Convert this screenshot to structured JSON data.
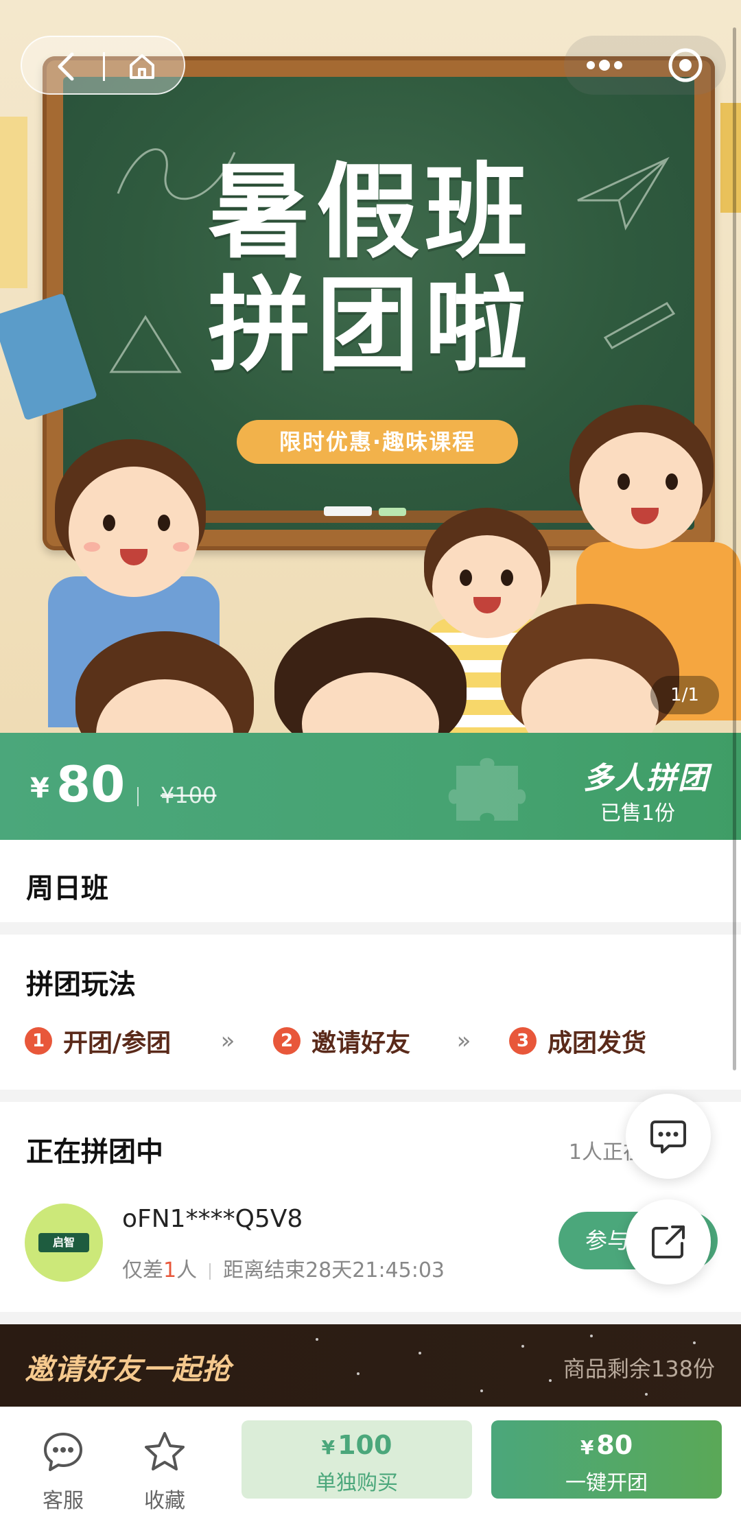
{
  "hero": {
    "title_line1": "暑假班",
    "title_line2": "拼团啦",
    "tagline": "限时优惠·趣味课程",
    "page_indicator": "1/1"
  },
  "nav": {
    "back_icon": "chevron-left-icon",
    "home_icon": "home-icon",
    "more_icon": "more-dots-icon",
    "close_icon": "target-icon"
  },
  "price": {
    "currency": "¥",
    "current": "80",
    "original": "¥100",
    "badge": "多人拼团",
    "sold": "已售1份"
  },
  "product": {
    "name": "周日班"
  },
  "rules": {
    "title": "拼团玩法",
    "steps": [
      {
        "num": "1",
        "label": "开团/参团"
      },
      {
        "num": "2",
        "label": "邀请好友"
      },
      {
        "num": "3",
        "label": "成团发货"
      }
    ],
    "arrow": "»"
  },
  "ongoing": {
    "title": "正在拼团中",
    "side_text": "1人正在拼",
    "member": {
      "avatar_text": "启智",
      "name": "oFN1****Q5V8",
      "need_prefix": "仅差",
      "need_count": "1",
      "need_suffix": "人",
      "countdown": "距离结束28天21:45:03"
    },
    "join_label": "参与"
  },
  "promo": {
    "title": "邀请好友一起抢",
    "stock": "商品剩余138份"
  },
  "bottom": {
    "service_label": "客服",
    "favorite_label": "收藏",
    "single_price_currency": "¥",
    "single_price": "100",
    "single_label": "单独购买",
    "group_price_currency": "¥",
    "group_price": "80",
    "group_label": "一键开团"
  },
  "colors": {
    "brand_green": "#4ba77b",
    "accent_orange": "#e8573a",
    "promo_gold": "#f5c98e"
  }
}
